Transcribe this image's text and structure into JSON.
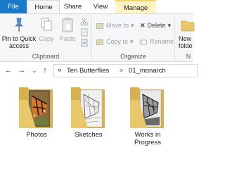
{
  "tabs": {
    "file": "File",
    "home": "Home",
    "share": "Share",
    "view": "View",
    "manage": "Manage"
  },
  "clipboard": {
    "pin_line1": "Pin to Quick",
    "pin_line2": "access",
    "copy": "Copy",
    "paste": "Paste",
    "group_label": "Clipboard"
  },
  "organize": {
    "move_to": "Move to",
    "delete": "Delete",
    "copy_to": "Copy to",
    "rename": "Rename",
    "group_label": "Organize"
  },
  "new_group": {
    "new_folder_line1": "New",
    "new_folder_line2": "folde",
    "group_label": "N"
  },
  "address": {
    "overflow": "«",
    "crumb1": "Ten Butterflies",
    "separator": ">",
    "crumb2": "01_monarch"
  },
  "folders": [
    {
      "line1": "Photos",
      "line2": ""
    },
    {
      "line1": "Sketches",
      "line2": ""
    },
    {
      "line1": "Works in",
      "line2": "Progress"
    }
  ],
  "colors": {
    "file_tab": "#1979ca",
    "manage_tab": "#fdf3c4",
    "folder": "#e9c86a",
    "folder_dark": "#d8b04f"
  }
}
